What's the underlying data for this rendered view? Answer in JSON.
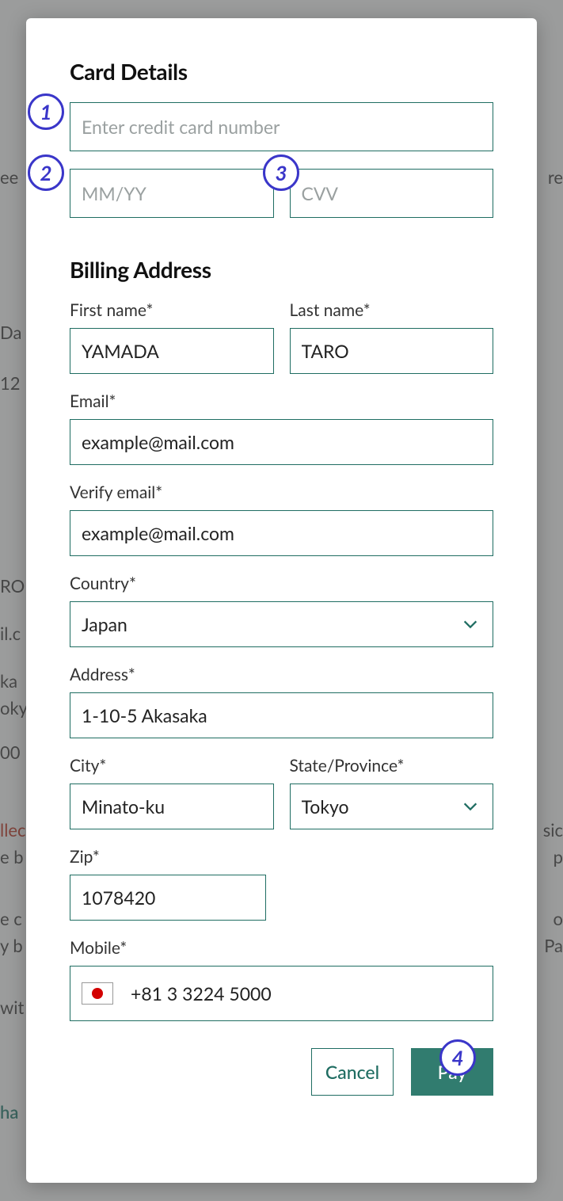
{
  "annotations": {
    "a1": "1",
    "a2": "2",
    "a3": "3",
    "a4": "4"
  },
  "card": {
    "heading": "Card Details",
    "number_placeholder": "Enter credit card number",
    "number_value": "",
    "expiry_placeholder": "MM/YY",
    "expiry_value": "",
    "cvv_placeholder": "CVV",
    "cvv_value": ""
  },
  "billing": {
    "heading": "Billing Address",
    "first_name_label": "First name*",
    "first_name_value": "YAMADA",
    "last_name_label": "Last name*",
    "last_name_value": "TARO",
    "email_label": "Email*",
    "email_value": "example@mail.com",
    "verify_email_label": "Verify email*",
    "verify_email_value": "example@mail.com",
    "country_label": "Country*",
    "country_value": "Japan",
    "address_label": "Address*",
    "address_value": "1-10-5 Akasaka",
    "city_label": "City*",
    "city_value": "Minato-ku",
    "state_label": "State/Province*",
    "state_value": "Tokyo",
    "zip_label": "Zip*",
    "zip_value": "1078420",
    "mobile_label": "Mobile*",
    "mobile_value": "+81 3 3224 5000"
  },
  "actions": {
    "cancel": "Cancel",
    "pay": "Pay"
  },
  "bg": {
    "t1": "ee",
    "t2": "re",
    "t3": "Da",
    "t4": "12",
    "t5": "RO",
    "t6": "il.c",
    "t7": "ka",
    "t8": "oky",
    "t9": "00",
    "t10": "llec",
    "t11": "e b",
    "t12": "p",
    "t13": "e c",
    "t14": "o",
    "t15": "y b",
    "t16": "Pa",
    "t17": "wit",
    "t18": "ha",
    "t19": "sic"
  }
}
